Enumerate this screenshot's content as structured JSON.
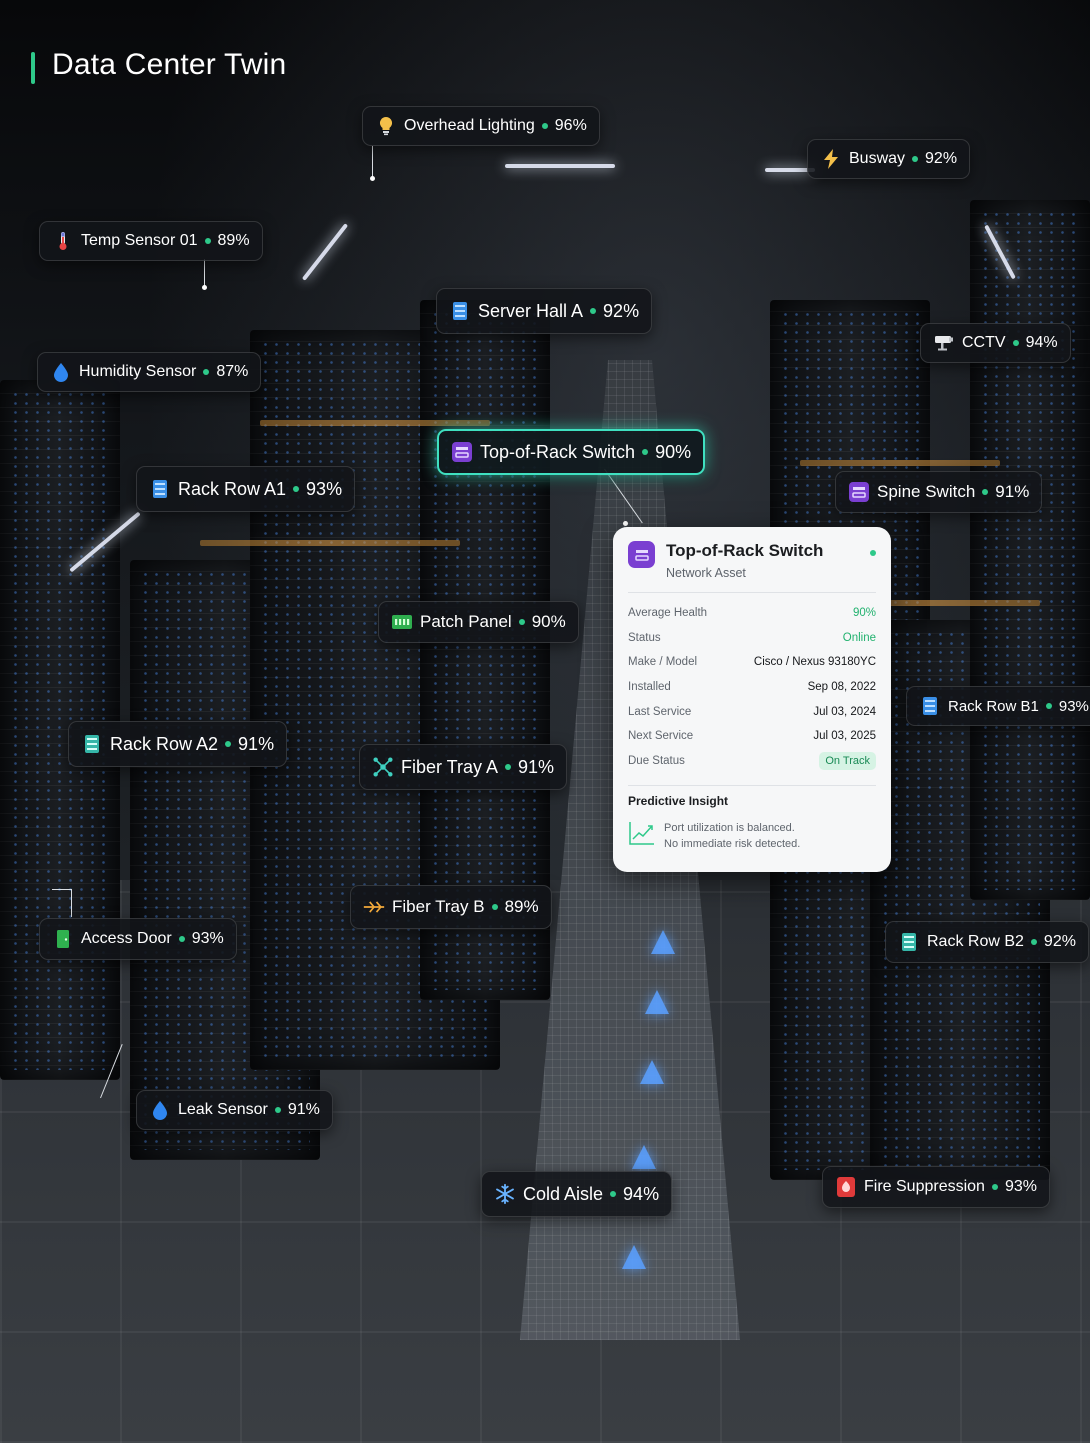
{
  "app": {
    "title": "Data Center Twin"
  },
  "colors": {
    "accent": "#2ec98a",
    "active_outline": "#3fe0c0",
    "card_bg": "#f6f7f8"
  },
  "tags": [
    {
      "id": "overhead-lighting",
      "label": "Overhead Lighting",
      "value": "96%",
      "icon": "lightbulb-icon"
    },
    {
      "id": "busway",
      "label": "Busway",
      "value": "92%",
      "icon": "lightning-icon"
    },
    {
      "id": "temp-sensor-01",
      "label": "Temp Sensor 01",
      "value": "89%",
      "icon": "thermometer-icon"
    },
    {
      "id": "server-hall-a",
      "label": "Server Hall A",
      "value": "92%",
      "icon": "server-icon"
    },
    {
      "id": "cctv",
      "label": "CCTV",
      "value": "94%",
      "icon": "camera-icon"
    },
    {
      "id": "humidity-sensor",
      "label": "Humidity Sensor",
      "value": "87%",
      "icon": "droplet-icon"
    },
    {
      "id": "top-of-rack-switch",
      "label": "Top-of-Rack Switch",
      "value": "90%",
      "icon": "switch-icon"
    },
    {
      "id": "rack-row-a1",
      "label": "Rack Row A1",
      "value": "93%",
      "icon": "rack-icon"
    },
    {
      "id": "spine-switch",
      "label": "Spine Switch",
      "value": "91%",
      "icon": "switch-icon"
    },
    {
      "id": "patch-panel",
      "label": "Patch Panel",
      "value": "90%",
      "icon": "patch-panel-icon"
    },
    {
      "id": "rack-row-b1",
      "label": "Rack Row B1",
      "value": "93%",
      "icon": "rack-icon"
    },
    {
      "id": "rack-row-a2",
      "label": "Rack Row A2",
      "value": "91%",
      "icon": "rack-icon"
    },
    {
      "id": "fiber-tray-a",
      "label": "Fiber Tray A",
      "value": "91%",
      "icon": "network-icon"
    },
    {
      "id": "fiber-tray-b",
      "label": "Fiber Tray B",
      "value": "89%",
      "icon": "fiber-icon"
    },
    {
      "id": "access-door",
      "label": "Access Door",
      "value": "93%",
      "icon": "door-icon"
    },
    {
      "id": "rack-row-b2",
      "label": "Rack Row B2",
      "value": "92%",
      "icon": "rack-icon"
    },
    {
      "id": "leak-sensor",
      "label": "Leak Sensor",
      "value": "91%",
      "icon": "droplet-icon"
    },
    {
      "id": "fire-suppression",
      "label": "Fire Suppression",
      "value": "93%",
      "icon": "fire-extinguisher-icon"
    },
    {
      "id": "cold-aisle",
      "label": "Cold Aisle",
      "value": "94%",
      "icon": "snowflake-icon"
    }
  ],
  "detail_card": {
    "title": "Top-of-Rack Switch",
    "subtitle": "Network Asset",
    "icon": "switch-icon",
    "rows": [
      {
        "key": "Average Health",
        "value": "90%"
      },
      {
        "key": "Status",
        "value": "Online"
      },
      {
        "key": "Make / Model",
        "value": "Cisco / Nexus 93180YC"
      },
      {
        "key": "Installed",
        "value": "Sep 08, 2022"
      },
      {
        "key": "Last Service",
        "value": "Jul 03, 2024"
      },
      {
        "key": "Next Service",
        "value": "Jul 03, 2025"
      },
      {
        "key": "Due Status",
        "value": "On Track"
      }
    ],
    "insight_title": "Predictive Insight",
    "insight_line1": "Port utilization is balanced.",
    "insight_line2": "No immediate risk detected."
  }
}
